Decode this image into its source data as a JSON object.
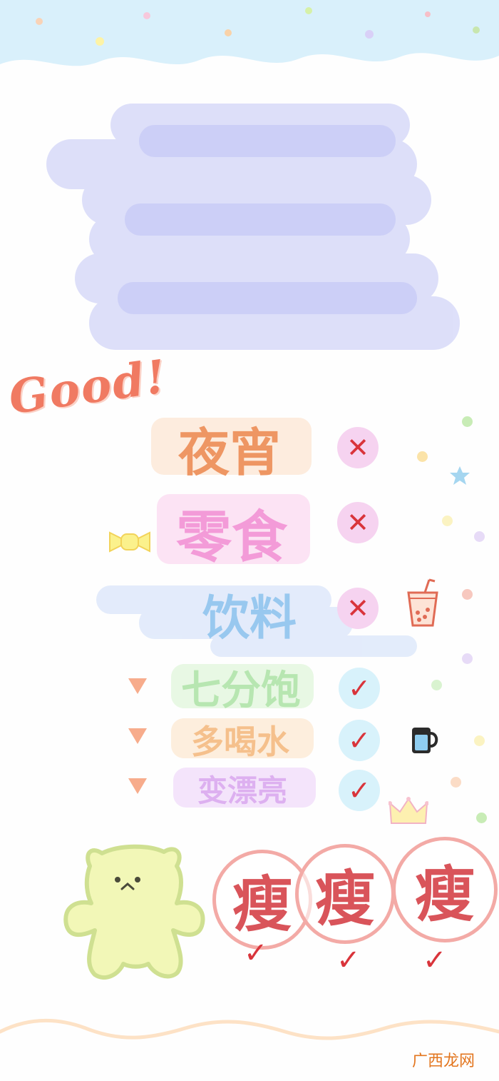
{
  "header": {
    "sky_color": "#d9f0fb"
  },
  "scribble": {
    "color": "#c8ccf7"
  },
  "good_text": "Good!",
  "rows": [
    {
      "label": "夜宵",
      "mark": "✕",
      "mark_icon": "cross-icon",
      "label_color": "#ee9663",
      "highlight": "#fde9d8",
      "circle": "#f6d3f0"
    },
    {
      "label": "零食",
      "mark": "✕",
      "mark_icon": "cross-icon",
      "label_color": "#f39bd8",
      "highlight": "#fce0f3",
      "circle": "#f6d3f0"
    },
    {
      "label": "饮料",
      "mark": "✕",
      "mark_icon": "cross-icon",
      "label_color": "#98c8ef",
      "highlight": "#e2ebfb",
      "circle": "#f6d3f0"
    },
    {
      "label": "七分饱",
      "mark": "✓",
      "mark_icon": "check-icon",
      "label_color": "#b7e6b1",
      "highlight": "#e8f8e4",
      "circle": "#d8f2fb"
    },
    {
      "label": "多喝水",
      "mark": "✓",
      "mark_icon": "check-icon",
      "label_color": "#f5c08c",
      "highlight": "#fdeedd",
      "circle": "#d8f2fb"
    },
    {
      "label": "变漂亮",
      "mark": "✓",
      "mark_icon": "check-icon",
      "label_color": "#ddb0f0",
      "highlight": "#f4e4fb",
      "circle": "#d8f2fb"
    }
  ],
  "shou": [
    {
      "char": "瘦",
      "check": "✓"
    },
    {
      "char": "瘦",
      "check": "✓"
    },
    {
      "char": "瘦",
      "check": "✓"
    }
  ],
  "colors": {
    "bear": "#f2f7b7",
    "bear_outline": "#cfe091",
    "footer_wave": "#fde2c6"
  },
  "watermark": "广西龙网"
}
